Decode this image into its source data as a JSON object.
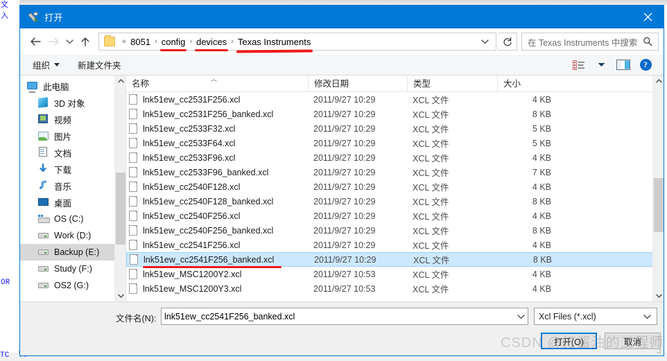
{
  "window": {
    "title": "打开",
    "title_icon": "iar-tools-icon",
    "close_label": "✕",
    "accent_color": "#0078d7"
  },
  "nav": {
    "back_label": "←",
    "forward_label": "→",
    "recent_label": "⌄",
    "up_label": "↑",
    "refresh_label": "↻",
    "folder_icon": "folder-icon",
    "crumb_prefix": "«",
    "breadcrumbs": [
      {
        "label": "8051",
        "underlined": false
      },
      {
        "label": "config",
        "underlined": true
      },
      {
        "label": "devices",
        "underlined": true
      },
      {
        "label": "Texas Instruments",
        "underlined": true
      }
    ],
    "separator": "›",
    "dropdown_label": "⌄"
  },
  "search": {
    "placeholder": "在 Texas Instruments 中搜索",
    "icon": "search-icon"
  },
  "commandbar": {
    "organize_label": "组织",
    "new_folder_label": "新建文件夹",
    "view_icon": "view-options-icon",
    "view_caret": "▾",
    "preview_pane_icon": "preview-pane-icon",
    "help_icon": "help-icon",
    "help_glyph": "?"
  },
  "sidebar": {
    "items": [
      {
        "label": "此电脑",
        "icon": "this-pc-icon",
        "indent": 0,
        "selected": false,
        "icon_class": "ic-pc"
      },
      {
        "label": "3D 对象",
        "icon": "3d-objects-icon",
        "indent": 1,
        "selected": false,
        "icon_class": "ic-3d"
      },
      {
        "label": "视频",
        "icon": "videos-icon",
        "indent": 1,
        "selected": false,
        "icon_class": "ic-video"
      },
      {
        "label": "图片",
        "icon": "pictures-icon",
        "indent": 1,
        "selected": false,
        "icon_class": "ic-pic"
      },
      {
        "label": "文档",
        "icon": "documents-icon",
        "indent": 1,
        "selected": false,
        "icon_class": "ic-doc"
      },
      {
        "label": "下载",
        "icon": "downloads-icon",
        "indent": 1,
        "selected": false,
        "icon_class": "ic-down"
      },
      {
        "label": "音乐",
        "icon": "music-icon",
        "indent": 1,
        "selected": false,
        "icon_class": "ic-music"
      },
      {
        "label": "桌面",
        "icon": "desktop-icon",
        "indent": 1,
        "selected": false,
        "icon_class": "ic-desktop"
      },
      {
        "label": "OS (C:)",
        "icon": "os-drive-icon",
        "indent": 1,
        "selected": false,
        "icon_class": "ic-drive-os"
      },
      {
        "label": "Work (D:)",
        "icon": "drive-icon",
        "indent": 1,
        "selected": false,
        "icon_class": "ic-drive"
      },
      {
        "label": "Backup (E:)",
        "icon": "drive-icon",
        "indent": 1,
        "selected": true,
        "icon_class": "ic-drive"
      },
      {
        "label": "Study (F:)",
        "icon": "drive-icon",
        "indent": 1,
        "selected": false,
        "icon_class": "ic-drive"
      },
      {
        "label": "OS2 (G:)",
        "icon": "drive-icon",
        "indent": 1,
        "selected": false,
        "icon_class": "ic-drive"
      }
    ]
  },
  "filelist": {
    "columns": [
      "名称",
      "修改日期",
      "类型",
      "大小"
    ],
    "sort_column": "名称",
    "sort_direction": "ascending",
    "sort_glyph": "︿",
    "rows": [
      {
        "name": "lnk51ew_cc2531F256.xcl",
        "date": "2011/9/27 10:29",
        "type": "XCL 文件",
        "size": "4 KB",
        "selected": false
      },
      {
        "name": "lnk51ew_cc2531F256_banked.xcl",
        "date": "2011/9/27 10:29",
        "type": "XCL 文件",
        "size": "8 KB",
        "selected": false
      },
      {
        "name": "lnk51ew_cc2533F32.xcl",
        "date": "2011/9/27 10:29",
        "type": "XCL 文件",
        "size": "5 KB",
        "selected": false
      },
      {
        "name": "lnk51ew_cc2533F64.xcl",
        "date": "2011/9/27 10:29",
        "type": "XCL 文件",
        "size": "5 KB",
        "selected": false
      },
      {
        "name": "lnk51ew_cc2533F96.xcl",
        "date": "2011/9/27 10:29",
        "type": "XCL 文件",
        "size": "4 KB",
        "selected": false
      },
      {
        "name": "lnk51ew_cc2533F96_banked.xcl",
        "date": "2011/9/27 10:29",
        "type": "XCL 文件",
        "size": "7 KB",
        "selected": false
      },
      {
        "name": "lnk51ew_cc2540F128.xcl",
        "date": "2011/9/27 10:29",
        "type": "XCL 文件",
        "size": "4 KB",
        "selected": false
      },
      {
        "name": "lnk51ew_cc2540F128_banked.xcl",
        "date": "2011/9/27 10:29",
        "type": "XCL 文件",
        "size": "8 KB",
        "selected": false
      },
      {
        "name": "lnk51ew_cc2540F256.xcl",
        "date": "2011/9/27 10:29",
        "type": "XCL 文件",
        "size": "4 KB",
        "selected": false
      },
      {
        "name": "lnk51ew_cc2540F256_banked.xcl",
        "date": "2011/9/27 10:29",
        "type": "XCL 文件",
        "size": "8 KB",
        "selected": false
      },
      {
        "name": "lnk51ew_cc2541F256.xcl",
        "date": "2011/9/27 10:29",
        "type": "XCL 文件",
        "size": "4 KB",
        "selected": false
      },
      {
        "name": "lnk51ew_cc2541F256_banked.xcl",
        "date": "2011/9/27 10:29",
        "type": "XCL 文件",
        "size": "8 KB",
        "selected": true
      },
      {
        "name": "lnk51ew_MSC1200Y2.xcl",
        "date": "2011/9/27 10:53",
        "type": "XCL 文件",
        "size": "4 KB",
        "selected": false
      },
      {
        "name": "lnk51ew_MSC1200Y3.xcl",
        "date": "2011/9/27 10:53",
        "type": "XCL 文件",
        "size": "4 KB",
        "selected": false
      }
    ]
  },
  "bottom": {
    "filename_label": "文件名(N):",
    "filename_value": "lnk51ew_cc2541F256_banked.xcl",
    "filename_chevron": "⌄",
    "filter_value": "Xcl Files (*.xcl)",
    "filter_chevron": "⌄",
    "open_label": "打开(O)",
    "cancel_label": "取消"
  },
  "watermark": {
    "text": "CSDN @打酱油的工程师"
  },
  "background": {
    "left_code": "文\n入\n\n\n\n\n\n\n\n\n\n\n\n\n\n\n\n\n\n\n\n\n\n\n\nOR",
    "bottom_code": "TC  TV"
  }
}
